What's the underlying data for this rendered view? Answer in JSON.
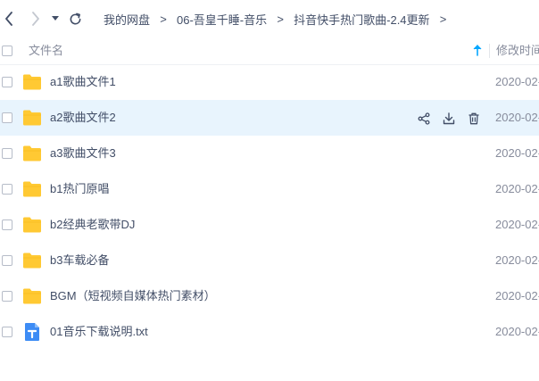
{
  "toolbar": {
    "back_icon": "chevron-left-icon",
    "forward_icon": "chevron-right-icon",
    "history_icon": "caret-down-icon",
    "refresh_icon": "refresh-icon"
  },
  "breadcrumb": {
    "items": [
      "我的网盘",
      "06-吾皇千睡-音乐",
      "抖音快手热门歌曲-2.4更新"
    ],
    "separator": ">"
  },
  "header": {
    "name_label": "文件名",
    "mtime_label": "修改时间",
    "sort_icon": "arrow-up-icon"
  },
  "colors": {
    "folder": "#ffc933",
    "txt": "#3d8cf5",
    "hover_row": "#e8f4fd",
    "accent": "#06a7ff"
  },
  "files": [
    {
      "name": "a1歌曲文件1",
      "type": "folder",
      "mtime": "2020-02-"
    },
    {
      "name": "a2歌曲文件2",
      "type": "folder",
      "mtime": "2020-02-",
      "hover": true
    },
    {
      "name": "a3歌曲文件3",
      "type": "folder",
      "mtime": "2020-02-"
    },
    {
      "name": "b1热门原唱",
      "type": "folder",
      "mtime": "2020-02-"
    },
    {
      "name": "b2经典老歌带DJ",
      "type": "folder",
      "mtime": "2020-02-"
    },
    {
      "name": "b3车载必备",
      "type": "folder",
      "mtime": "2020-02-"
    },
    {
      "name": "BGM（短视频自媒体热门素材）",
      "type": "folder",
      "mtime": "2020-02-"
    },
    {
      "name": "01音乐下载说明.txt",
      "type": "txt",
      "mtime": "2020-02-"
    }
  ],
  "row_actions": [
    "share-icon",
    "download-icon",
    "delete-icon"
  ]
}
